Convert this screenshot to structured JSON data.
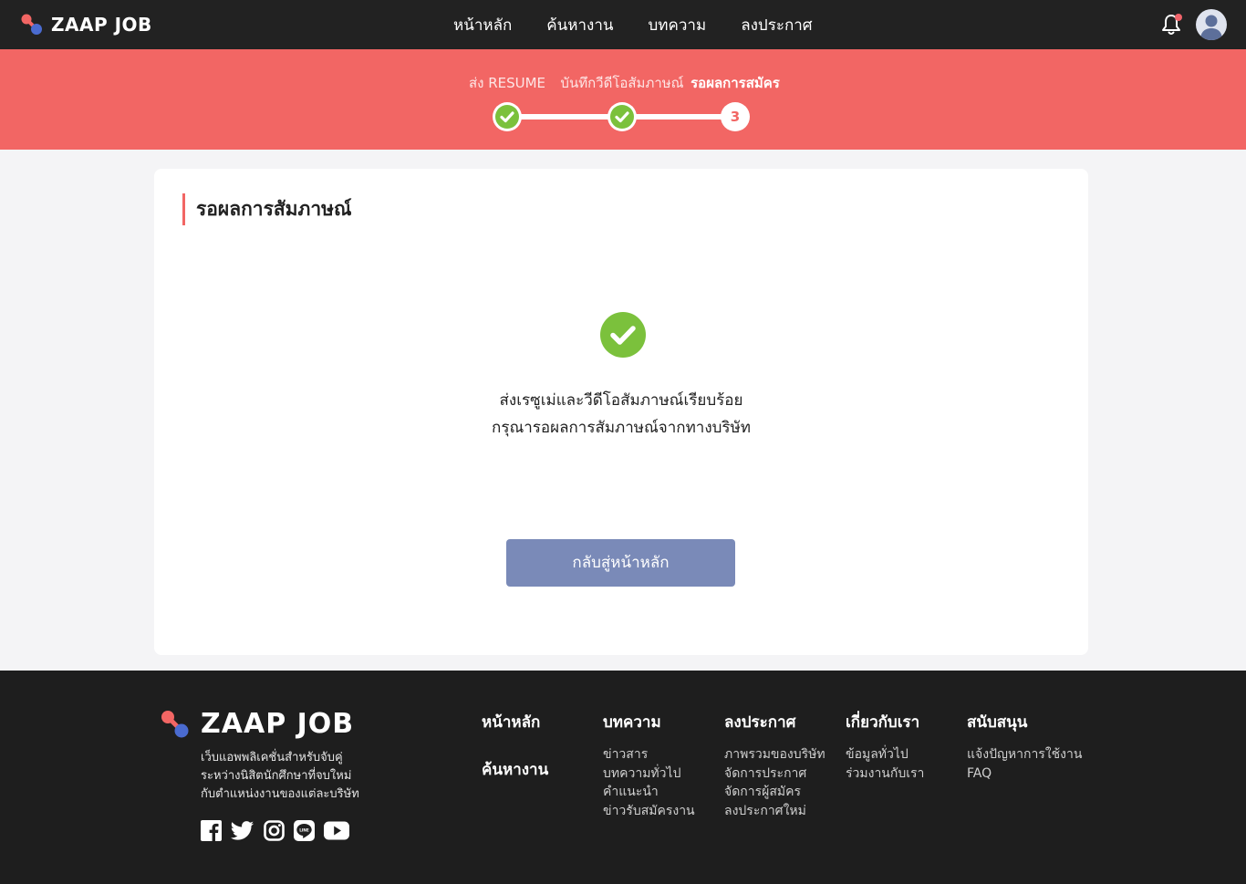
{
  "brand": {
    "name": "ZAAP JOB"
  },
  "nav": {
    "items": [
      {
        "label": "หน้าหลัก"
      },
      {
        "label": "ค้นหางาน"
      },
      {
        "label": "บทความ"
      },
      {
        "label": "ลงประกาศ"
      }
    ]
  },
  "steps": {
    "items": [
      {
        "label": "ส่ง RESUME",
        "status": "done"
      },
      {
        "label": "บันทึกวีดีโอสัมภาษณ์",
        "status": "done"
      },
      {
        "label": "รอผลการสมัคร",
        "status": "current",
        "number": "3"
      }
    ]
  },
  "main": {
    "title": "รอผลการสัมภาษณ์",
    "message_line1": "ส่งเรซูเม่และวีดีโอสัมภาษณ์เรียบร้อย",
    "message_line2": "กรุณารอผลการสัมภาษณ์จากทางบริษัท",
    "back_button": "กลับสู่หน้าหลัก"
  },
  "footer": {
    "brand": "ZAAP JOB",
    "desc": [
      "เว็บแอพพลิเคชั่นสำหรับจับคู่",
      "ระหว่างนิสิตนักศึกษาที่จบใหม่",
      "กับตำแหน่งงานของแต่ละบริษัท"
    ],
    "col_home": {
      "head1": "หน้าหลัก",
      "head2": "ค้นหางาน"
    },
    "col_articles": {
      "head": "บทความ",
      "links": [
        "ข่าวสาร",
        "บทความทั่วไป",
        "คำแนะนำ",
        "ข่าวรับสมัครงาน"
      ]
    },
    "col_post": {
      "head": "ลงประกาศ",
      "links": [
        "ภาพรวมของบริษัท",
        "จัดการประกาศ",
        "จัดการผู้สมัคร",
        "ลงประกาศใหม่"
      ]
    },
    "col_about": {
      "head": "เกี่ยวกับเรา",
      "links": [
        "ข้อมูลทั่วไป",
        "ร่วมงานกับเรา"
      ]
    },
    "col_support": {
      "head": "สนับสนุน",
      "links": [
        "แจ้งปัญหาการใช้งาน",
        "FAQ"
      ]
    }
  },
  "colors": {
    "topbar": "#222222",
    "accent": "#f26664",
    "success": "#7bc13c",
    "button": "#7a8ab8",
    "footer": "#1e1e1e"
  },
  "icons": [
    "logo-mark",
    "bell-icon",
    "avatar",
    "check-icon",
    "facebook-icon",
    "twitter-icon",
    "instagram-icon",
    "line-icon",
    "youtube-icon"
  ]
}
